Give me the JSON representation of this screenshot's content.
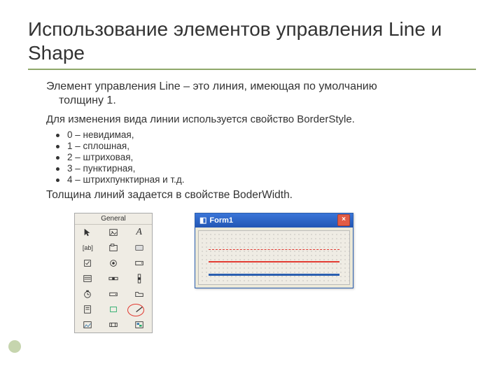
{
  "title": "Использование элементов управления Line и Shape",
  "lead_line1": "Элемент управления Line – это линия, имеющая по умолчанию",
  "lead_line2": "толщину 1.",
  "sub1": "Для изменения вида  линии используется свойство BorderStyle.",
  "items": [
    "0 – невидимая,",
    "1 – сплошная,",
    "2 – штриховая,",
    "3 – пунктирная,",
    "4 – штрихпунктирная и т.д."
  ],
  "last": "Толщина линий задается в свойстве BoderWidth.",
  "toolbox": {
    "header": "General"
  },
  "formwin": {
    "title": "Form1",
    "close": "×"
  }
}
